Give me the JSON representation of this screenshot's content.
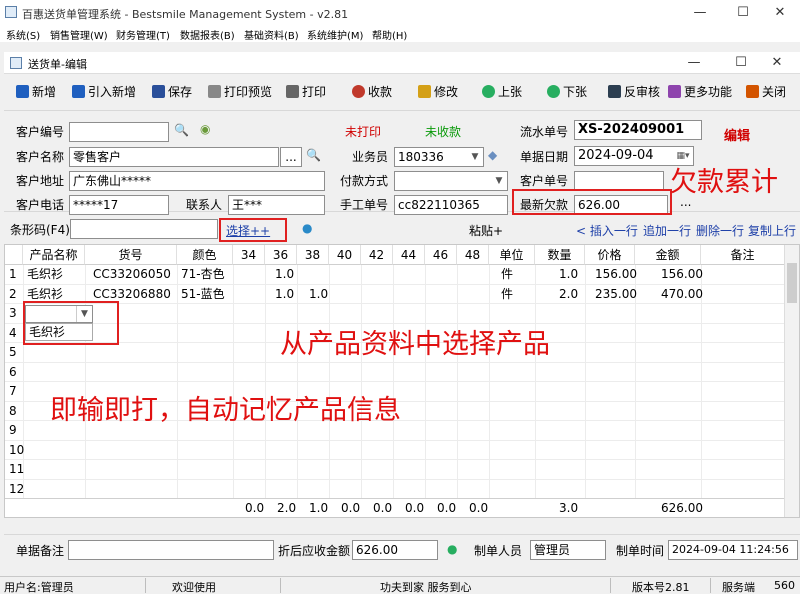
{
  "window": {
    "title": "百惠送货单管理系统 - Bestsmile Management System  - v2.81",
    "minimize": "—",
    "maximize": "☐",
    "close": "✕"
  },
  "menu": [
    "系统(S)",
    "销售管理(W)",
    "财务管理(T)",
    "数据报表(B)",
    "基础资料(B)",
    "系统维护(M)",
    "帮助(H)"
  ],
  "child_window": {
    "title": "送货单-编辑"
  },
  "toolbar": [
    {
      "label": "新增",
      "icon": "plus-icon",
      "color": "#1f5fbf"
    },
    {
      "label": "引入新增",
      "icon": "plus-icon",
      "color": "#1f5fbf"
    },
    {
      "label": "保存",
      "icon": "save-icon",
      "color": "#2a4f9a"
    },
    {
      "label": "打印预览",
      "icon": "print-preview-icon",
      "color": "#777777"
    },
    {
      "label": "打印",
      "icon": "printer-icon",
      "color": "#555555"
    },
    {
      "label": "收款",
      "icon": "payment-icon",
      "color": "#c0392b"
    },
    {
      "label": "修改",
      "icon": "edit-icon",
      "color": "#d4a017"
    },
    {
      "label": "上张",
      "icon": "previous-icon",
      "color": "#27ae60"
    },
    {
      "label": "下张",
      "icon": "next-icon",
      "color": "#27ae60"
    },
    {
      "label": "反审核",
      "icon": "unapprove-icon",
      "color": "#2c3e50"
    },
    {
      "label": "更多功能",
      "icon": "more-icon",
      "color": "#8e44ad"
    },
    {
      "label": "关闭",
      "icon": "close-icon",
      "color": "#d35400"
    }
  ],
  "form": {
    "customer_code_label": "客户编号",
    "customer_code": "",
    "customer_name_label": "客户名称",
    "customer_name": "零售客户",
    "address_label": "客户地址",
    "address": "广东佛山*****",
    "phone_label": "客户电话",
    "phone": "*****17",
    "contact_label": "联系人",
    "contact": "王***",
    "print_status": "未打印",
    "payment_status": "未收款",
    "salesman_label": "业务员",
    "salesman": "180336",
    "payment_method_label": "付款方式",
    "payment_method": "",
    "manual_no_label": "手工单号",
    "manual_no": "cc822110365",
    "serial_label": "流水单号",
    "serial": "XS-202409001",
    "editing_tag": "编辑",
    "date_label": "单据日期",
    "date": "2024-09-04",
    "customer_order_label": "客户单号",
    "customer_order": "",
    "debt_label": "最新欠款",
    "debt": "626.00",
    "ellipsis": "...",
    "calendar": "▦▾"
  },
  "barcode": {
    "label": "条形码(F4)",
    "value": "",
    "select_btn": "选择++",
    "paste": "粘贴+",
    "insert_row": "< 插入一行",
    "append_row": "追加一行",
    "delete_row": "删除一行",
    "copy_row": "复制上行"
  },
  "grid": {
    "headers": [
      "",
      "产品名称",
      "货号",
      "颜色",
      "34",
      "36",
      "38",
      "40",
      "42",
      "44",
      "46",
      "48",
      "单位",
      "数量",
      "价格",
      "金额",
      "备注"
    ],
    "rows": [
      {
        "no": "1",
        "name": "毛织衫",
        "sku": "CC33206050",
        "color": "71-杏色",
        "s36": "1.0",
        "s38": "",
        "unit": "件",
        "qty": "1.0",
        "price": "156.00",
        "amount": "156.00"
      },
      {
        "no": "2",
        "name": "毛织衫",
        "sku": "CC33206880",
        "color": "51-蓝色",
        "s36": "1.0",
        "s38": "1.0",
        "unit": "件",
        "qty": "2.0",
        "price": "235.00",
        "amount": "470.00"
      },
      {
        "no": "3"
      },
      {
        "no": "4"
      },
      {
        "no": "5"
      },
      {
        "no": "6"
      },
      {
        "no": "7"
      },
      {
        "no": "8"
      },
      {
        "no": "9"
      },
      {
        "no": "10"
      },
      {
        "no": "11"
      },
      {
        "no": "12"
      }
    ],
    "dropdown_option": "毛织衫",
    "totals": [
      "0.0",
      "2.0",
      "1.0",
      "0.0",
      "0.0",
      "0.0",
      "0.0",
      "0.0",
      "3.0",
      "626.00"
    ]
  },
  "annotations": {
    "debt_accum": "欠款累计",
    "select_from_catalog": "从产品资料中选择产品",
    "instant_memory": "即输即打，自动记忆产品信息"
  },
  "footer": {
    "remark_label": "单据备注",
    "remark": "",
    "discount_label": "折后应收金额",
    "discount_value": "626.00",
    "creator_label": "制单人员",
    "creator": "管理员",
    "time_label": "制单时间",
    "time": "2024-09-04 11:24:56"
  },
  "status": {
    "user": "用户名:管理员",
    "welcome": "欢迎使用",
    "slogan": "功夫到家 服务到心",
    "version": "版本号2.81",
    "server": "服务端",
    "server_value": "560"
  },
  "colors": {
    "accent_red": "#e01010",
    "status_green": "#0a9a0a"
  }
}
